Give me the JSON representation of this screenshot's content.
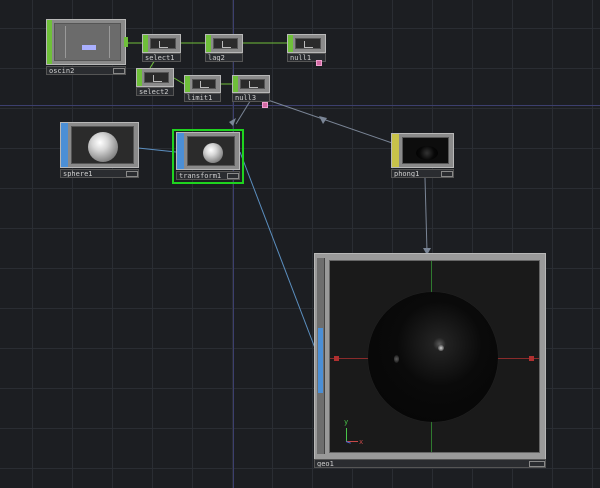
{
  "network": {
    "nodes": {
      "oscin2": "oscin2",
      "select1": "select1",
      "lag2": "lag2",
      "null1": "null1",
      "select2": "select2",
      "limit1": "limit1",
      "null3": "null3",
      "sphere1": "sphere1",
      "transform1": "transform1",
      "phong1": "phong1",
      "geo1": "geo1"
    },
    "gizmo": {
      "x": "x",
      "y": "y"
    }
  },
  "colors": {
    "chop": "#6fbf3a",
    "sop": "#4b8fd6",
    "mat": "#c8c24a",
    "selected": "#1fd31f",
    "wire_chop": "#6fbf3a",
    "wire_sop": "#5b8fc0",
    "wire_mat": "#7a8596"
  }
}
